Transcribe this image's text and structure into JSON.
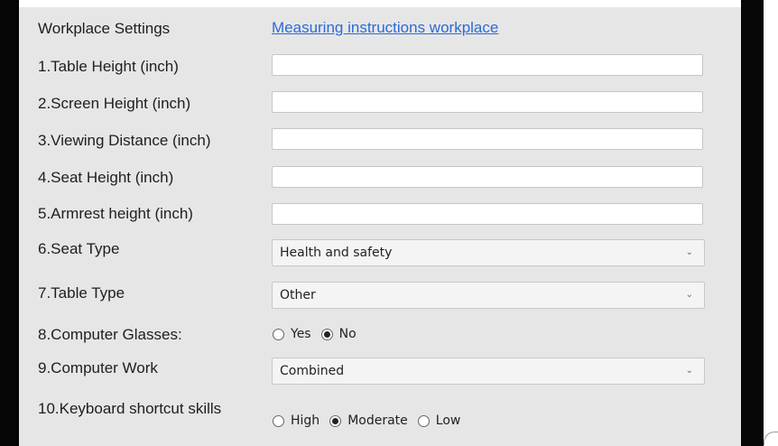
{
  "form": {
    "section_title": "Workplace Settings",
    "instructions_link": "Measuring instructions workplace",
    "fields": {
      "table_height": {
        "label": "1.Table Height (inch)",
        "value": ""
      },
      "screen_height": {
        "label": "2.Screen Height (inch)",
        "value": ""
      },
      "viewing_distance": {
        "label": "3.Viewing Distance (inch)",
        "value": ""
      },
      "seat_height": {
        "label": "4.Seat Height (inch)",
        "value": ""
      },
      "armrest_height": {
        "label": "5.Armrest height (inch)",
        "value": ""
      },
      "seat_type": {
        "label": "6.Seat Type",
        "selected": "Health and safety"
      },
      "table_type": {
        "label": "7.Table Type",
        "selected": "Other"
      },
      "computer_glasses": {
        "label": "8.Computer Glasses:",
        "options": [
          "Yes",
          "No"
        ],
        "selected": "No"
      },
      "computer_work": {
        "label": "9.Computer Work",
        "selected": "Combined"
      },
      "keyboard_skills": {
        "label": "10.Keyboard shortcut skills",
        "options": [
          "High",
          "Moderate",
          "Low"
        ],
        "selected": "Moderate"
      }
    }
  },
  "icons": {
    "dropdown": "chevron-down-icon"
  },
  "colors": {
    "panel": "#e6e6e6",
    "link": "#2c6bd6",
    "frame": "#050505"
  }
}
